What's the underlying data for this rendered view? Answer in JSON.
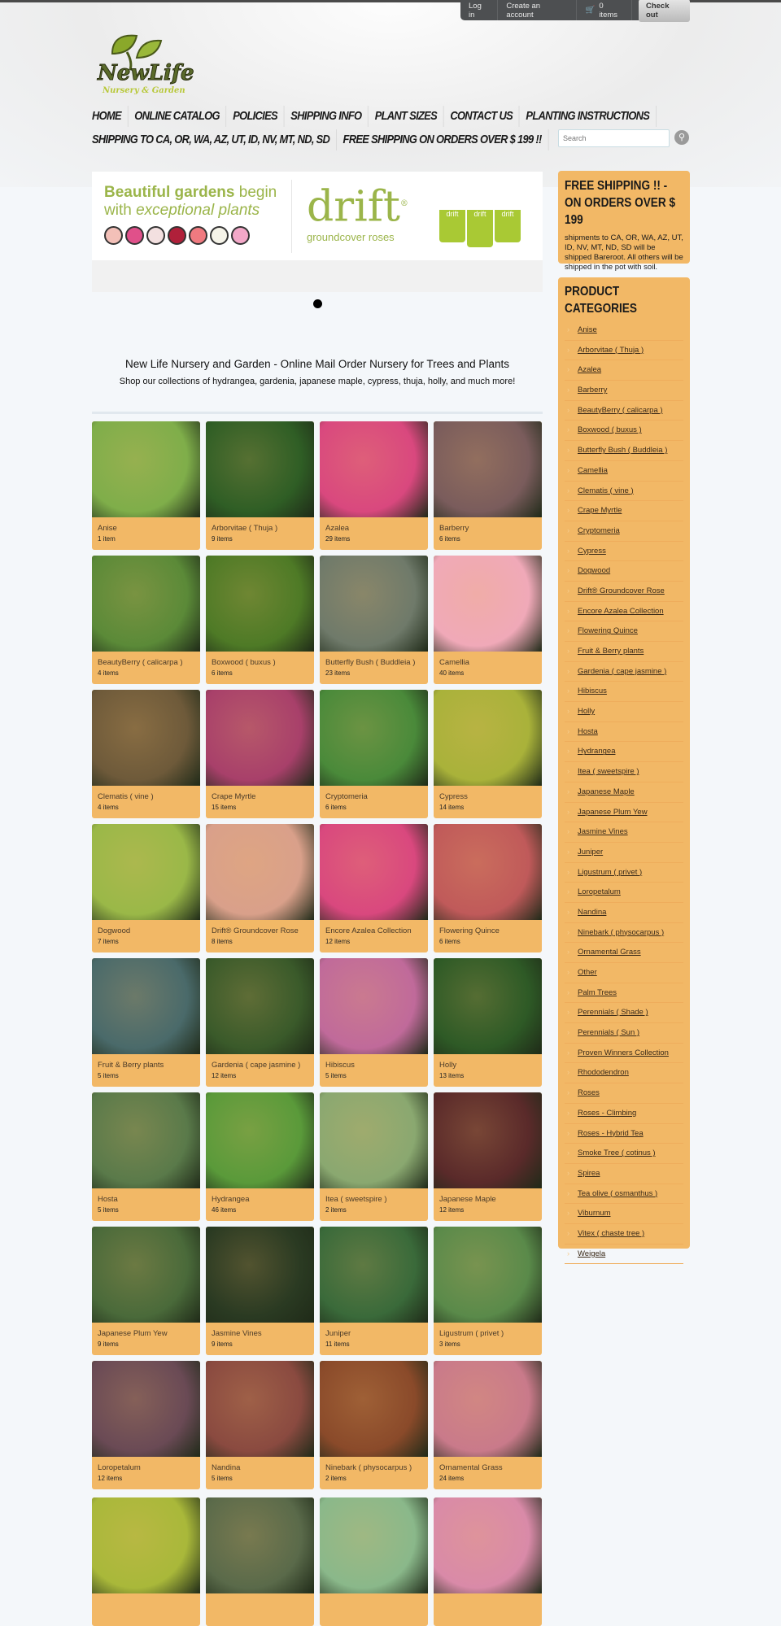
{
  "topbar": {
    "login": "Log in",
    "create_account": "Create an account",
    "cart": "0 items",
    "checkout": "Check out"
  },
  "logo": {
    "text": "NewLife",
    "subtext": "Nursery & Garden"
  },
  "nav": {
    "row1": [
      "HOME",
      "ONLINE CATALOG",
      "POLICIES",
      "SHIPPING INFO",
      "PLANT SIZES",
      "CONTACT US",
      "PLANTING INSTRUCTIONS"
    ],
    "row2": [
      "SHIPPING TO CA, OR, WA, AZ, UT, ID, NV, MT, ND, SD",
      "FREE SHIPPING ON ORDERS OVER $ 199 !!"
    ]
  },
  "search": {
    "placeholder": "Search"
  },
  "banner": {
    "line1a": "Beautiful gardens",
    "line1b": " begin",
    "line2a": "with ",
    "line2b": "exceptional plants",
    "brand": "drift",
    "reg": "®",
    "tagline": "groundcover roses",
    "pot_label": "drift"
  },
  "intro": {
    "title": "New Life Nursery and Garden - Online Mail Order Nursery for Trees and Plants",
    "subtitle": "Shop our collections of hydrangea, gardenia, japanese maple, cypress, thuja, holly, and much more!"
  },
  "tiles": [
    {
      "name": "Anise",
      "count": "1 item",
      "color": "#7fae4a"
    },
    {
      "name": "Arborvitae ( Thuja )",
      "count": "9 items",
      "color": "#2f5e25"
    },
    {
      "name": "Azalea",
      "count": "29 items",
      "color": "#d9487e"
    },
    {
      "name": "Barberry",
      "count": "6 items",
      "color": "#7a5c5c"
    },
    {
      "name": "BeautyBerry ( calicarpa )",
      "count": "4 items",
      "color": "#5b8a38"
    },
    {
      "name": "Boxwood ( buxus )",
      "count": "6 items",
      "color": "#4e7a26"
    },
    {
      "name": "Butterfly Bush ( Buddleia )",
      "count": "23 items",
      "color": "#6f7a6a"
    },
    {
      "name": "Camellia",
      "count": "40 items",
      "color": "#f0a9b8"
    },
    {
      "name": "Clematis ( vine )",
      "count": "4 items",
      "color": "#6e5a3a"
    },
    {
      "name": "Crape Myrtle",
      "count": "15 items",
      "color": "#a8406a"
    },
    {
      "name": "Cryptomeria",
      "count": "6 items",
      "color": "#4a8a3a"
    },
    {
      "name": "Cypress",
      "count": "14 items",
      "color": "#a9b23a"
    },
    {
      "name": "Dogwood",
      "count": "7 items",
      "color": "#9ab848"
    },
    {
      "name": "Drift® Groundcover Rose",
      "count": "8 items",
      "color": "#d9a08a"
    },
    {
      "name": "Encore Azalea Collection",
      "count": "12 items",
      "color": "#d9487e"
    },
    {
      "name": "Flowering Quince",
      "count": "6 items",
      "color": "#c05a5a"
    },
    {
      "name": "Fruit & Berry plants",
      "count": "5 items",
      "color": "#4a6a6a"
    },
    {
      "name": "Gardenia ( cape jasmine )",
      "count": "12 items",
      "color": "#3a5a2a"
    },
    {
      "name": "Hibiscus",
      "count": "5 items",
      "color": "#c06a9a"
    },
    {
      "name": "Holly",
      "count": "13 items",
      "color": "#2e5a26"
    },
    {
      "name": "Hosta",
      "count": "5 items",
      "color": "#5a7a4a"
    },
    {
      "name": "Hydrangea",
      "count": "46 items",
      "color": "#5a9a3a"
    },
    {
      "name": "Itea ( sweetspire )",
      "count": "2 items",
      "color": "#8aa870"
    },
    {
      "name": "Japanese Maple",
      "count": "12 items",
      "color": "#5a2a2a"
    },
    {
      "name": "Japanese Plum Yew",
      "count": "9 items",
      "color": "#4a6a3a"
    },
    {
      "name": "Jasmine Vines",
      "count": "9 items",
      "color": "#2a3a22"
    },
    {
      "name": "Juniper",
      "count": "11 items",
      "color": "#3a6a3a"
    },
    {
      "name": "Ligustrum ( privet )",
      "count": "3 items",
      "color": "#5a8a4a"
    },
    {
      "name": "Loropetalum",
      "count": "12 items",
      "color": "#6a4a55"
    },
    {
      "name": "Nandina",
      "count": "5 items",
      "color": "#8a4a40"
    },
    {
      "name": "Ninebark ( physocarpus )",
      "count": "2 items",
      "color": "#8a4a2a"
    },
    {
      "name": "Ornamental Grass",
      "count": "24 items",
      "color": "#c97a8a"
    }
  ],
  "partial_tiles": [
    {
      "color": "#a9b83a"
    },
    {
      "color": "#5a6a4a"
    },
    {
      "color": "#8ab88a"
    },
    {
      "color": "#d98aa8"
    }
  ],
  "free_shipping": {
    "title": "FREE SHIPPING !! - ON ORDERS OVER $ 199",
    "text": "shipments to CA, OR, WA, AZ, UT, ID, NV, MT, ND, SD will be shipped Bareroot. All others will be shipped in the pot with soil."
  },
  "categories": {
    "title": "PRODUCT CATEGORIES",
    "items": [
      "Anise",
      "Arborvitae ( Thuja )",
      "Azalea",
      "Barberry",
      "BeautyBerry ( calicarpa )",
      "Boxwood ( buxus )",
      "Butterfly Bush ( Buddleia )",
      "Camellia",
      "Clematis ( vine )",
      "Crape Myrtle",
      "Cryptomeria",
      "Cypress",
      "Dogwood",
      "Drift® Groundcover Rose",
      "Encore Azalea Collection",
      "Flowering Quince",
      "Fruit & Berry plants",
      "Gardenia ( cape jasmine )",
      "Hibiscus",
      "Holly",
      "Hosta",
      "Hydrangea",
      "Itea ( sweetspire )",
      "Japanese Maple",
      "Japanese Plum Yew",
      "Jasmine Vines",
      "Juniper",
      "Ligustrum ( privet )",
      "Loropetalum",
      "Nandina",
      "Ninebark ( physocarpus )",
      "Ornamental Grass",
      "Other",
      "Palm Trees",
      "Perennials ( Shade )",
      "Perennials ( Sun )",
      "Proven Winners Collection",
      "Rhododendron",
      "Roses",
      "Roses - Climbing",
      "Roses - Hybrid Tea",
      "Smoke Tree ( cotinus )",
      "Spirea",
      "Tea olive ( osmanthus )",
      "Viburnum",
      "Vitex ( chaste tree )",
      "Weigela"
    ]
  },
  "colors": {
    "accent": "#f2b866",
    "topbar": "#4d4f51",
    "banner_green": "#9bb54a"
  }
}
